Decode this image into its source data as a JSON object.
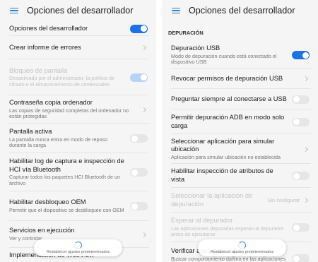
{
  "left": {
    "header": {
      "title": "Opciones del desarrollador"
    },
    "items": [
      {
        "title": "Opciones del desarrollador",
        "control": "toggle",
        "state": "on"
      },
      {
        "title": "Crear informe de errores",
        "control": "chevron"
      },
      {
        "title": "Bloqueo de pantalla",
        "subtitle": "Desactivado por el administrador, la política de cifrado o el almacenamiento de credenciales",
        "control": "toggle",
        "state": "on",
        "disabled": true
      },
      {
        "title": "Contraseña copia ordenador",
        "subtitle": "Las copias de seguridad completas del ordenador no están protegidas",
        "control": "chevron"
      },
      {
        "title": "Pantalla activa",
        "subtitle": "La pantalla nunca entra en modo de reposo durante la carga",
        "control": "toggle",
        "state": "off"
      },
      {
        "title": "Habilitar log de captura e inspección de HCI vía Bluetooth",
        "subtitle": "Capturar todos los paquetes HCI Bluetooth de un archivo",
        "control": "toggle",
        "state": "off"
      },
      {
        "title": "Habilitar desbloqueo OEM",
        "subtitle": "Permitir que el dispositivo se desbloquee con OEM",
        "control": "toggle",
        "state": "off"
      },
      {
        "title": "Servicios en ejecución",
        "subtitle": "Ver y controlar",
        "control": "chevron"
      },
      {
        "title": "Implementación de WebView",
        "control": "none"
      }
    ],
    "toast": {
      "text": "Restablecer ajustes predeterminados"
    }
  },
  "right": {
    "header": {
      "title": "Opciones del desarrollador"
    },
    "section": "DEPURACIÓN",
    "items": [
      {
        "title": "Depuración USB",
        "subtitle": "Modo de depuración cuando está conectado el dispositivo USB",
        "control": "toggle",
        "state": "on"
      },
      {
        "title": "Revocar permisos de depuración USB",
        "control": "chevron"
      },
      {
        "title": "Preguntar siempre al conectarse a USB",
        "control": "toggle",
        "state": "off"
      },
      {
        "title": "Permitir depuración ADB en modo solo carga",
        "control": "toggle",
        "state": "off"
      },
      {
        "title": "Seleccionar aplicación para simular ubicación",
        "subtitle": "Aplicación para simular ubicación no establecida",
        "control": "chevron"
      },
      {
        "title": "Habilitar inspección de atributos de vista",
        "control": "toggle",
        "state": "off"
      },
      {
        "title": "Seleccionar la aplicación de depuración",
        "value": "Sin configurar",
        "control": "chevron",
        "disabled": true
      },
      {
        "title": "Esperar al depurador",
        "subtitle": "Las aplicaciones depuradas esperan al depurador antes de ejecutarse",
        "control": "toggle",
        "state": "off",
        "disabled": true
      },
      {
        "title": "Verificar apps por USB",
        "subtitle": "Buscar comportamiento dañino en las aplicaciones",
        "control": "toggle",
        "state": "off"
      }
    ],
    "toast": {
      "text": "Restablecer ajustes predeterminados"
    }
  },
  "colors": {
    "accent": "#1b73e6",
    "toggle_off": "#e6e6e6",
    "background": "#f5f5f5"
  }
}
